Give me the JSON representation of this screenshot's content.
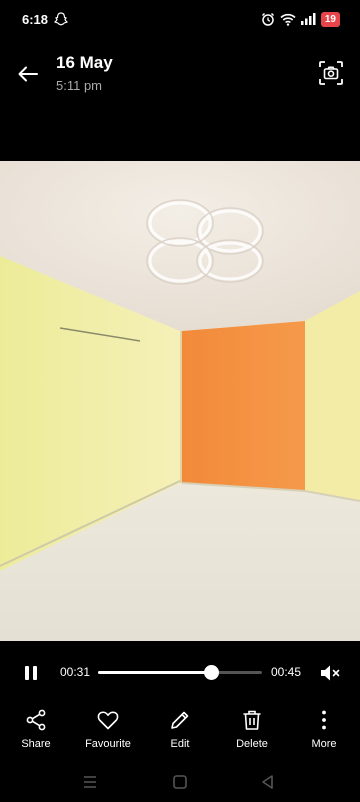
{
  "status_bar": {
    "time": "6:18",
    "icons": [
      "snapchat-icon",
      "alarm-icon",
      "wifi-icon",
      "signal-icon"
    ],
    "battery": "19",
    "battery_color": "#e8454a"
  },
  "header": {
    "title": "16 May",
    "subtitle": "5:11 pm",
    "back_icon": "arrow-left-icon",
    "screenshot_icon": "camera-capture-icon"
  },
  "player": {
    "current_time": "00:31",
    "total_time": "00:45",
    "progress": 0.69,
    "state_icon": "pause-icon",
    "volume_icon": "volume-muted-icon"
  },
  "actions": [
    {
      "label": "Share",
      "icon": "share-icon"
    },
    {
      "label": "Favourite",
      "icon": "heart-icon"
    },
    {
      "label": "Edit",
      "icon": "pencil-icon"
    },
    {
      "label": "Delete",
      "icon": "trash-icon"
    },
    {
      "label": "More",
      "icon": "more-vertical-icon"
    }
  ],
  "nav_bar": {
    "icons": [
      "menu-icon",
      "home-icon",
      "back-triangle-icon"
    ]
  },
  "colors": {
    "background": "#000000",
    "accent_wall": "#f08a3c"
  }
}
